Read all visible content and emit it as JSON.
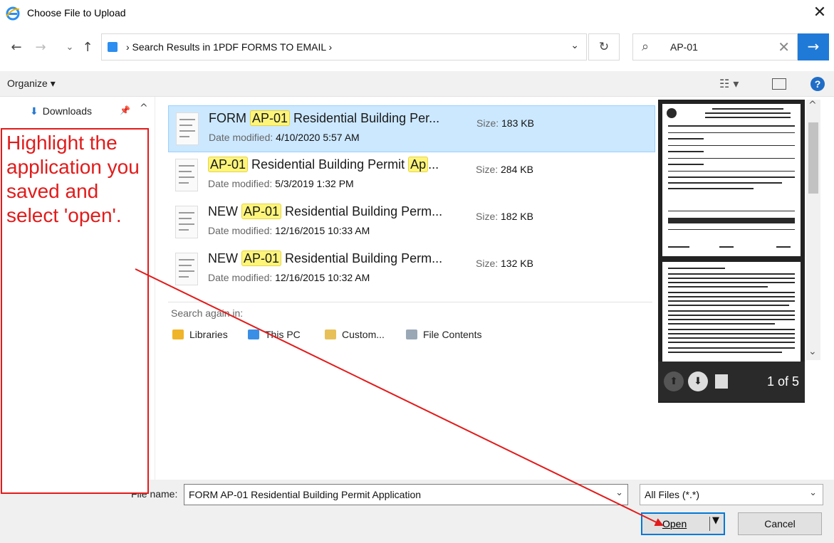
{
  "window": {
    "title": "Choose File to Upload",
    "close_glyph": "✕"
  },
  "nav": {
    "back_glyph": "←",
    "forward_glyph": "→",
    "recent_glyph": "⌄",
    "up_glyph": "↑",
    "address": "›  Search Results in 1PDF FORMS TO EMAIL  ›",
    "address_dropdown_glyph": "⌄",
    "refresh_glyph": "↻",
    "search_value": "AP-01",
    "search_glyph": "⌕",
    "clear_glyph": "✕",
    "go_glyph": "→"
  },
  "toolbar": {
    "organize_label": "Organize ▾",
    "view_glyph": "☷ ▾",
    "help_glyph": "?"
  },
  "sidebar": {
    "items": [
      {
        "label": "Downloads",
        "icon": "download-arrow-icon"
      }
    ],
    "pin_glyph": "📌",
    "scroll_up_glyph": "^"
  },
  "files": [
    {
      "pre": "FORM ",
      "match": "AP-01",
      "post": " Residential Building Per...",
      "date_label": "Date modified:",
      "date": "4/10/2020 5:57 AM",
      "size_label": "Size:",
      "size": "183 KB",
      "selected": true
    },
    {
      "pre": "",
      "match": "AP-01",
      "post": " Residential Building Permit ",
      "match2": "Ap",
      "post2": "...",
      "date_label": "Date modified:",
      "date": "5/3/2019 1:32 PM",
      "size_label": "Size:",
      "size": "284 KB",
      "selected": false
    },
    {
      "pre": "NEW ",
      "match": "AP-01",
      "post": " Residential Building Perm...",
      "date_label": "Date modified:",
      "date": "12/16/2015 10:33 AM",
      "size_label": "Size:",
      "size": "182 KB",
      "selected": false
    },
    {
      "pre": "NEW ",
      "match": "AP-01",
      "post": " Residential Building Perm...",
      "date_label": "Date modified:",
      "date": "12/16/2015 10:32 AM",
      "size_label": "Size:",
      "size": "132 KB",
      "selected": false
    }
  ],
  "search_again": {
    "label": "Search again in:",
    "locations": [
      {
        "label": "Libraries",
        "icon": "libraries-icon",
        "color": "#f0b429"
      },
      {
        "label": "This PC",
        "icon": "computer-icon",
        "color": "#3a8ee6"
      },
      {
        "label": "Custom...",
        "icon": "folder-icon",
        "color": "#e8c05a"
      },
      {
        "label": "File Contents",
        "icon": "document-search-icon",
        "color": "#9aa7b5"
      }
    ]
  },
  "preview": {
    "page_count": "1 of 5",
    "prev_glyph": "⬆",
    "next_glyph": "⬇",
    "scroll_up_glyph": "^",
    "scroll_down_glyph": "⌄"
  },
  "bottom": {
    "filename_label": "File name:",
    "filename_value": "FORM AP-01 Residential Building Permit  Application",
    "filename_dropdown_glyph": "⌄",
    "filter_value": "All Files (*.*)",
    "filter_dropdown_glyph": "⌄",
    "open_label": "Open",
    "open_split_glyph": "▼",
    "cancel_label": "Cancel"
  },
  "annotation": {
    "text": "Highlight the application you saved and select 'open'.",
    "color": "#e21b1b"
  },
  "colors": {
    "selection": "#cce8ff",
    "highlight": "#fdf57a",
    "accent": "#1f7ad7"
  }
}
